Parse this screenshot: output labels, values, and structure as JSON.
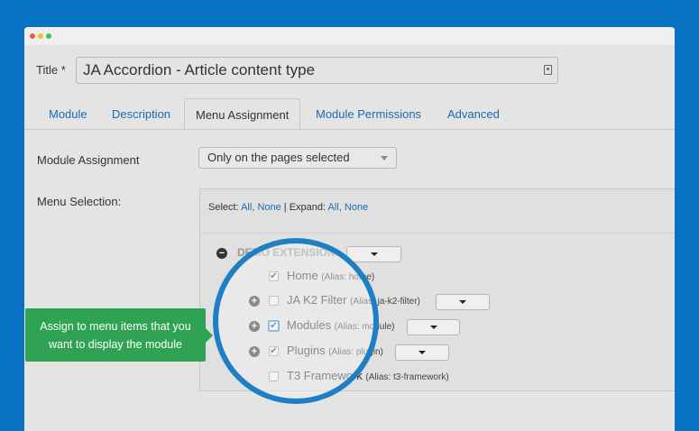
{
  "colors": {
    "background": "#0a72c2",
    "accent": "#1e7fc4",
    "tooltip": "#2fa353",
    "link": "#1a6bb3"
  },
  "title_field": {
    "label": "Title *",
    "value": "JA Accordion - Article content type"
  },
  "tabs": [
    {
      "label": "Module"
    },
    {
      "label": "Description"
    },
    {
      "label": "Menu Assignment"
    },
    {
      "label": "Module Permissions"
    },
    {
      "label": "Advanced"
    }
  ],
  "module_assignment": {
    "label": "Module Assignment",
    "selected": "Only on the pages selected"
  },
  "menu_selection": {
    "label": "Menu Selection:",
    "select_label": "Select:",
    "select_all": "All,",
    "select_none": "None",
    "separator": "|",
    "expand_label": "Expand:",
    "expand_all": "All,",
    "expand_none": "None"
  },
  "tree": {
    "group_title": "DEMO EXTENSION",
    "items": [
      {
        "title": "Home",
        "alias": "(Alias: home)",
        "checked": true
      },
      {
        "title": "JA K2 Filter",
        "alias": "(Alias: ja-k2-filter)",
        "checked": false
      },
      {
        "title": "Modules",
        "alias": "(Alias: module)",
        "checked": true
      },
      {
        "title": "Plugins",
        "alias": "(Alias: plugin)",
        "checked": true
      },
      {
        "title": "T3 Framework",
        "alias": "(Alias: t3-framework)",
        "checked": false
      }
    ]
  },
  "tooltip": {
    "line1": "Assign to menu items that you",
    "line2": "want to display the module"
  }
}
